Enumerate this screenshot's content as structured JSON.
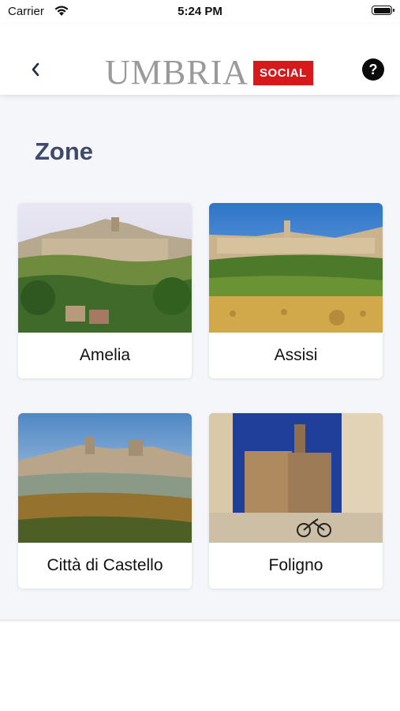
{
  "status_bar": {
    "carrier": "Carrier",
    "time": "5:24 PM"
  },
  "header": {
    "logo_text": "UMBRIA",
    "logo_badge": "SOCIAL",
    "help_label": "?",
    "back_icon": "chevron-left-icon",
    "brand_color": "#d7191c"
  },
  "page": {
    "title": "Zone"
  },
  "zones": [
    {
      "name": "Amelia"
    },
    {
      "name": "Assisi"
    },
    {
      "name": "Città di Castello"
    },
    {
      "name": "Foligno"
    }
  ]
}
